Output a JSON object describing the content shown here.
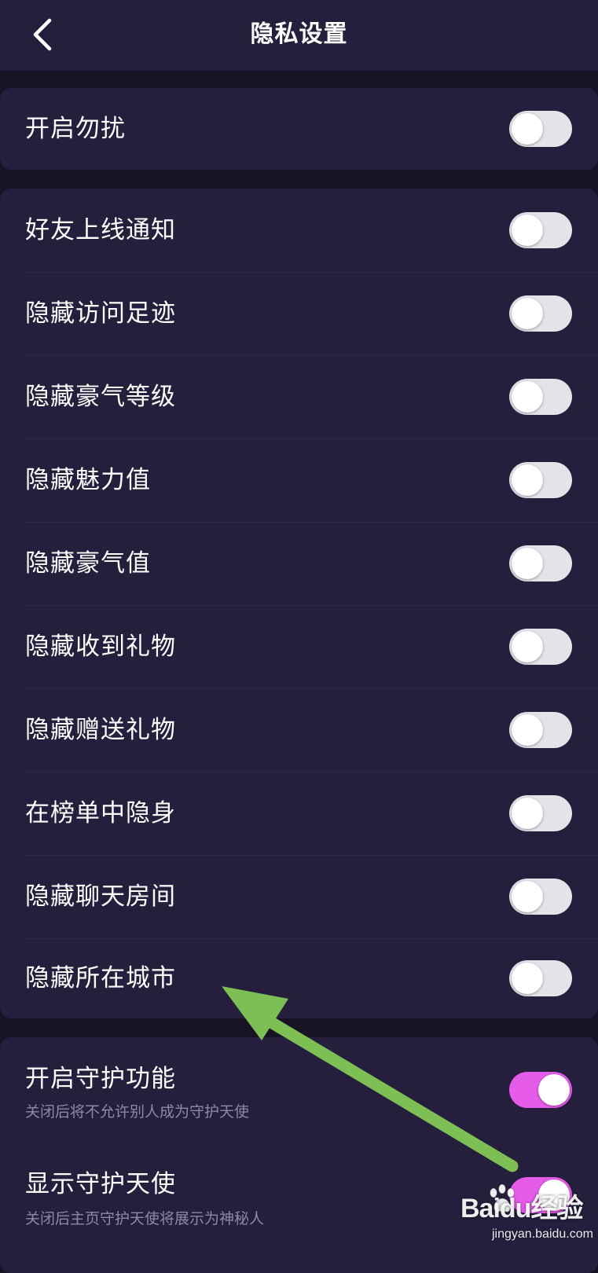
{
  "header": {
    "title": "隐私设置",
    "back_icon": "chevron-left-icon"
  },
  "colors": {
    "background": "#171224",
    "card": "#251E3D",
    "toggle_off": "#E3E3EA",
    "toggle_on": "#E55BEA",
    "annotation_arrow": "#7DBE55"
  },
  "groups": [
    {
      "items": [
        {
          "label": "开启勿扰",
          "on": false
        }
      ]
    },
    {
      "items": [
        {
          "label": "好友上线通知",
          "on": false
        },
        {
          "label": "隐藏访问足迹",
          "on": false
        },
        {
          "label": "隐藏豪气等级",
          "on": false
        },
        {
          "label": "隐藏魅力值",
          "on": false
        },
        {
          "label": "隐藏豪气值",
          "on": false
        },
        {
          "label": "隐藏收到礼物",
          "on": false
        },
        {
          "label": "隐藏赠送礼物",
          "on": false
        },
        {
          "label": "在榜单中隐身",
          "on": false
        },
        {
          "label": "隐藏聊天房间",
          "on": false
        },
        {
          "label": "隐藏所在城市",
          "on": false
        }
      ]
    },
    {
      "items": [
        {
          "label": "开启守护功能",
          "description": "关闭后将不允许别人成为守护天使",
          "on": true
        },
        {
          "label": "显示守护天使",
          "description": "关闭后主页守护天使将展示为神秘人",
          "on": true
        }
      ]
    }
  ],
  "watermark": {
    "logo": "Baidu经验",
    "sub": "jingyan.baidu.com"
  }
}
